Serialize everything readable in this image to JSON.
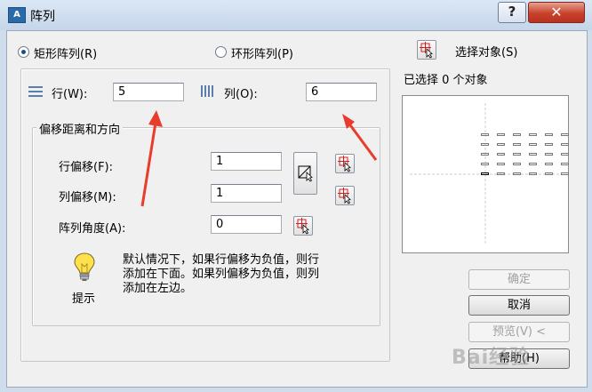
{
  "window": {
    "title": "阵列",
    "app_icon": "A",
    "help_glyph": "?",
    "close_glyph": "✕"
  },
  "layout_mode": {
    "rectangular_label": "矩形阵列(R)",
    "polar_label": "环形阵列(P)",
    "selected": "rectangular"
  },
  "selection": {
    "select_objects_label": "选择对象(S)",
    "status": "已选择 0 个对象"
  },
  "rows": {
    "label": "行(W):",
    "value": "5"
  },
  "columns": {
    "label": "列(O):",
    "value": "6"
  },
  "offset": {
    "group_label": "偏移距离和方向",
    "row_offset_label": "行偏移(F):",
    "row_offset_value": "1",
    "column_offset_label": "列偏移(M):",
    "column_offset_value": "1",
    "angle_label": "阵列角度(A):",
    "angle_value": "0"
  },
  "tip": {
    "label": "提示",
    "text_line1": "默认情况下，如果行偏移为负值，则行",
    "text_line2": "添加在下面。如果列偏移为负值，则列",
    "text_line3": "添加在左边。"
  },
  "buttons": {
    "ok_label": "确定",
    "cancel_label": "取消",
    "preview_label": "预览(V) <",
    "help_label": "帮助(H)"
  },
  "watermark_text": "Bai经验",
  "colors": {
    "annotation_arrow": "#e83c2c",
    "close_button": "#c7412c",
    "title_bar": "#c5d6ea"
  },
  "icons": {
    "rows": "rows-grid-icon",
    "columns": "columns-grid-icon",
    "pick": "pick-point-cursor-icon",
    "pick_both": "pick-offset-both-icon",
    "tip": "lightbulb-icon"
  }
}
